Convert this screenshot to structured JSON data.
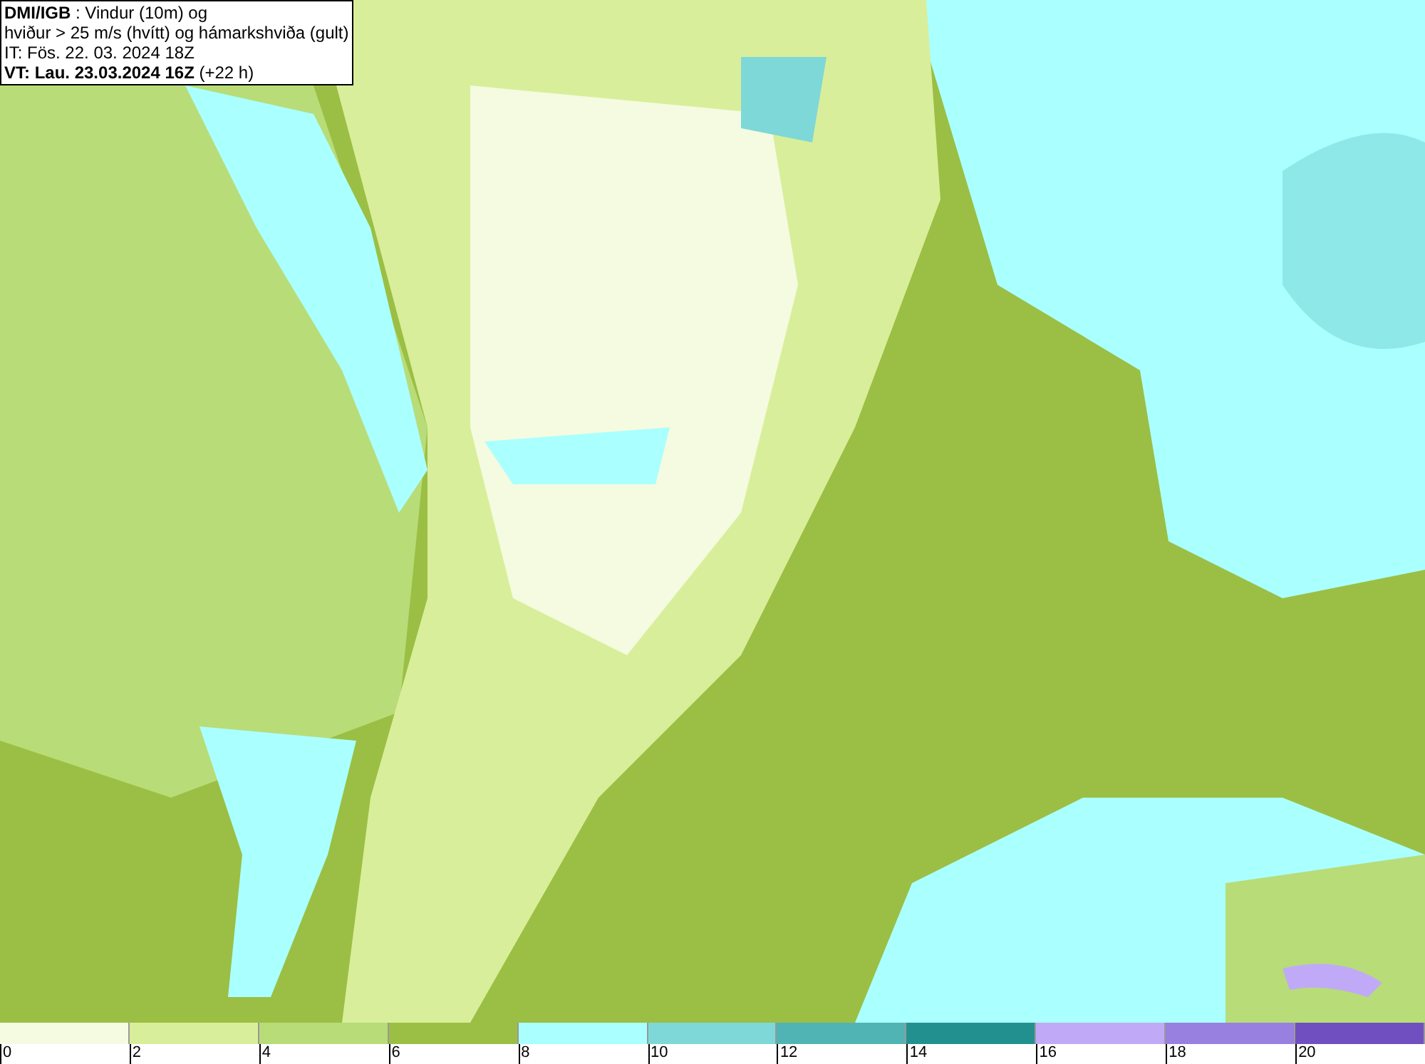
{
  "title_box": {
    "lines": [
      "**DMI/IGB** : Vindur (10m) og",
      "hviður > 25 m/s (hvítt) og hámarkshviða (gult)",
      "IT: Fös. 22. 03. 2024 18Z",
      "**VT: Lau. 23.03.2024 16Z** (+22 h)"
    ]
  },
  "legend": {
    "bins": [
      {
        "label": "0",
        "color": "#f4fbe0"
      },
      {
        "label": "2",
        "color": "#d9ee9a"
      },
      {
        "label": "4",
        "color": "#b8dc78"
      },
      {
        "label": "6",
        "color": "#9bbf44"
      },
      {
        "label": "8",
        "color": "#aaffff"
      },
      {
        "label": "10",
        "color": "#7ed8d8"
      },
      {
        "label": "12",
        "color": "#50b4b4"
      },
      {
        "label": "14",
        "color": "#239090"
      },
      {
        "label": "16",
        "color": "#c0aaf8"
      },
      {
        "label": "18",
        "color": "#9880e0"
      },
      {
        "label": "20",
        "color": "#7050c0"
      }
    ]
  }
}
